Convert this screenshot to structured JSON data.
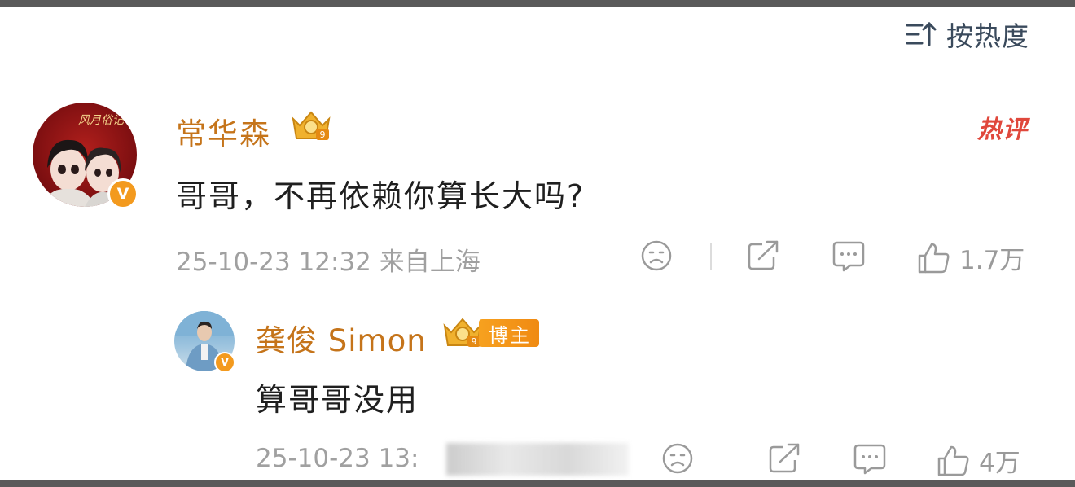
{
  "sort": {
    "label": "按热度",
    "icon": "sort-icon"
  },
  "comment": {
    "author": "常华森",
    "text": "哥哥，不再依赖你算长大吗?",
    "meta": "25-10-23 12:32 来自上海",
    "hot_tag": "热评",
    "like_count": "1.7万",
    "avatar_text": "风月俗记"
  },
  "reply": {
    "author": "龚俊 Simon",
    "badge": "博主",
    "text": "算哥哥没用",
    "meta": "25-10-23 13:",
    "like_count": "4万"
  },
  "colors": {
    "name": "#c5741a",
    "hot": "#e0483c",
    "badge_orange": "#f39a1e",
    "meta_gray": "#a0a0a0",
    "icon_gray": "#9a9a9a"
  }
}
